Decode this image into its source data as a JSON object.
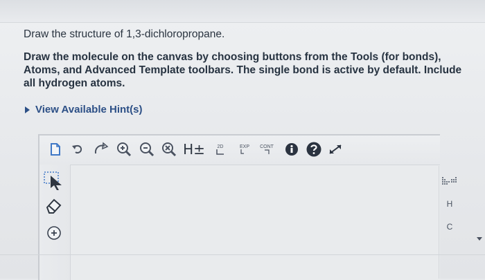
{
  "question": {
    "title": "Draw the structure of 1,3-dichloropropane.",
    "instructions": "Draw the molecule on the canvas by choosing buttons from the Tools (for bonds), Atoms, and Advanced Template toolbars. The single bond is active by default. Include all hydrogen atoms.",
    "hint_link": "View Available Hint(s)"
  },
  "toolbar": {
    "tools": [
      {
        "name": "new-document-icon"
      },
      {
        "name": "undo-icon"
      },
      {
        "name": "redo-icon"
      },
      {
        "name": "zoom-in-icon"
      },
      {
        "name": "zoom-out-icon"
      },
      {
        "name": "clear-icon"
      },
      {
        "name": "hydrogen-toggle",
        "label": "H±"
      },
      {
        "name": "2d-clean-icon",
        "label": "2D"
      },
      {
        "name": "expand-icon",
        "label": "EXP"
      },
      {
        "name": "contract-icon",
        "label": "CONT"
      },
      {
        "name": "info-icon"
      },
      {
        "name": "help-icon"
      },
      {
        "name": "fullscreen-icon"
      }
    ]
  },
  "left_tools": [
    {
      "name": "select-tool-icon"
    },
    {
      "name": "eraser-icon"
    },
    {
      "name": "positive-charge-icon"
    }
  ],
  "atoms": {
    "items": [
      "H",
      "C"
    ]
  },
  "colors": {
    "hint_link": "#2c4f86",
    "help_badge": "#2b3340",
    "info_badge": "#2b3340",
    "select_tool": "#3f78c6"
  }
}
